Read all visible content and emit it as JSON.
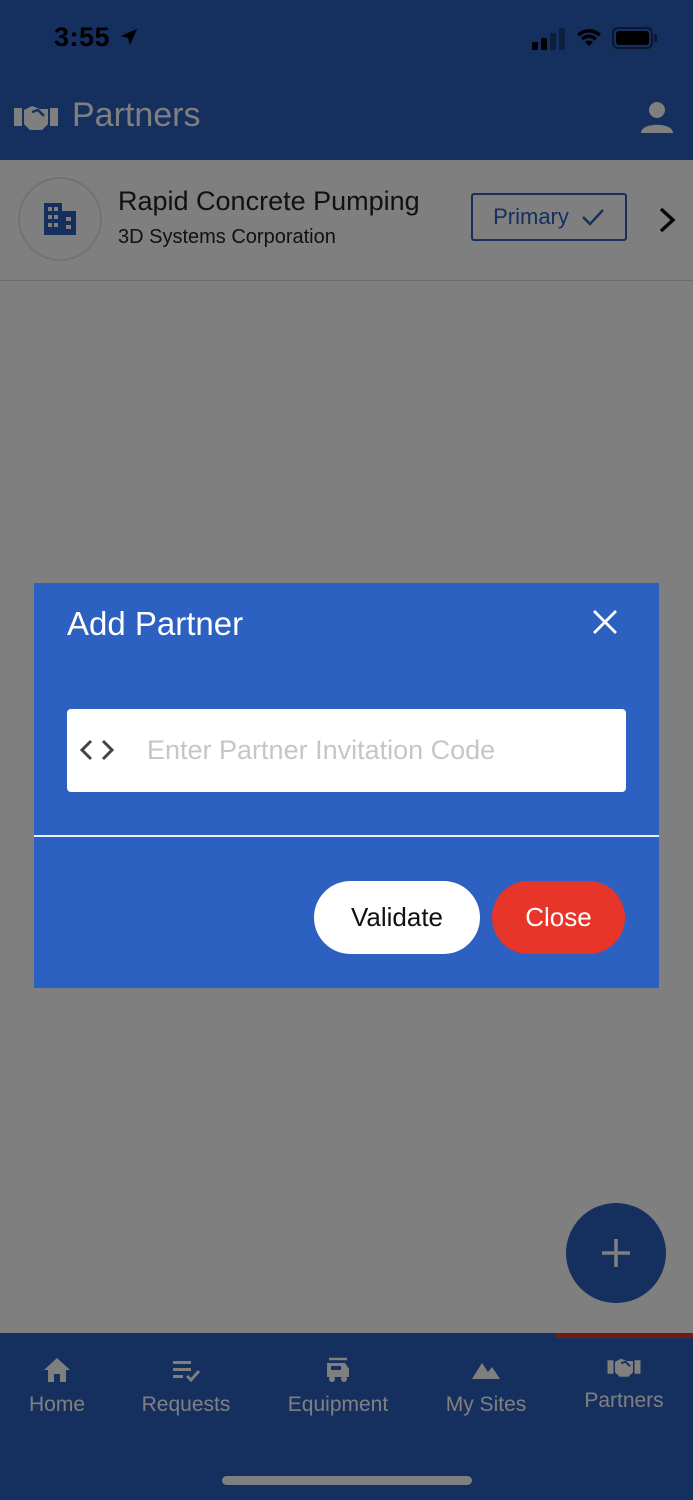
{
  "status_bar": {
    "time": "3:55"
  },
  "header": {
    "title": "Partners",
    "icon": "handshake-icon",
    "user_icon": "user-icon"
  },
  "partner_list": [
    {
      "name": "Rapid Concrete Pumping",
      "company": "3D Systems Corporation",
      "badge": "Primary",
      "icon": "building-icon"
    }
  ],
  "modal": {
    "title": "Add Partner",
    "code_placeholder": "Enter Partner Invitation Code",
    "code_value": "",
    "validate_label": "Validate",
    "close_label": "Close"
  },
  "bottom_nav": {
    "items": [
      {
        "label": "Home",
        "icon": "home-icon"
      },
      {
        "label": "Requests",
        "icon": "requests-icon"
      },
      {
        "label": "Equipment",
        "icon": "equipment-icon"
      },
      {
        "label": "My Sites",
        "icon": "mountain-icon"
      },
      {
        "label": "Partners",
        "icon": "handshake-icon"
      }
    ],
    "active": "Partners"
  },
  "colors": {
    "primary": "#2a5ebf",
    "modal": "#2c61c2",
    "danger": "#e8352a",
    "active_indicator": "#e8352a"
  }
}
